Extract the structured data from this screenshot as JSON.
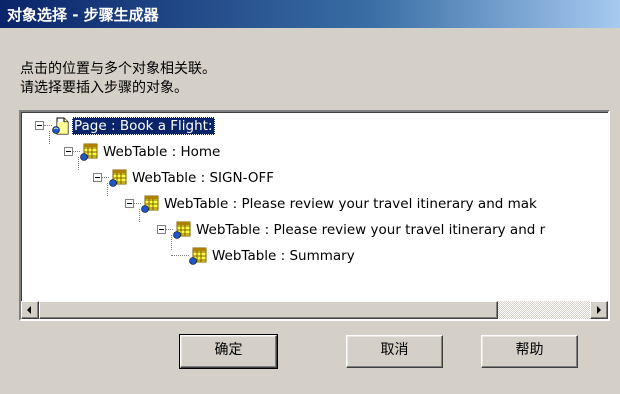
{
  "window": {
    "title": "对象选择 - 步骤生成器"
  },
  "message": {
    "line1": "点击的位置与多个对象相关联。",
    "line2": "请选择要插入步骤的对象。"
  },
  "tree": {
    "nodes": [
      {
        "label": "Page : Book a Flight:",
        "icon": "page-icon",
        "selected": true
      },
      {
        "label": "WebTable : Home",
        "icon": "webtable-icon"
      },
      {
        "label": "WebTable : SIGN-OFF",
        "icon": "webtable-icon"
      },
      {
        "label": "WebTable : Please review your travel itinerary and mak",
        "icon": "webtable-icon"
      },
      {
        "label": "WebTable : Please review your travel itinerary and r",
        "icon": "webtable-icon"
      },
      {
        "label": "WebTable : Summary",
        "icon": "webtable-icon"
      }
    ]
  },
  "buttons": {
    "ok": "确定",
    "cancel": "取消",
    "help": "帮助"
  },
  "colors": {
    "titlebar_start": "#0a246a",
    "titlebar_end": "#a6caf0",
    "selection": "#0a246a",
    "dialog_bg": "#d4d0c8"
  }
}
